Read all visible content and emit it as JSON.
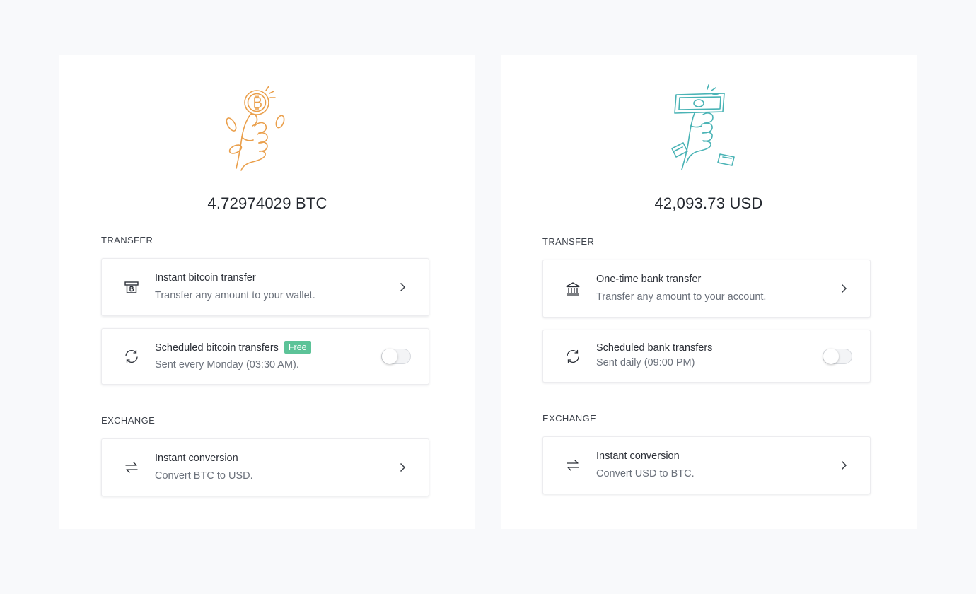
{
  "btc_panel": {
    "balance": "4.72974029 BTC",
    "illustration_color": "#ea9f4b",
    "transfer_label": "TRANSFER",
    "instant": {
      "title": "Instant bitcoin transfer",
      "subtitle": "Transfer any amount to your wallet.",
      "icon": "bitcoin-atm-icon"
    },
    "scheduled": {
      "title": "Scheduled bitcoin transfers",
      "badge": "Free",
      "subtitle": "Sent every Monday (03:30 AM).",
      "icon": "refresh-icon",
      "enabled": false
    },
    "exchange_label": "EXCHANGE",
    "conversion": {
      "title": "Instant conversion",
      "subtitle": "Convert BTC to USD.",
      "icon": "swap-arrows-icon"
    }
  },
  "usd_panel": {
    "balance": "42,093.73 USD",
    "illustration_color": "#49b3b5",
    "transfer_label": "TRANSFER",
    "onetime": {
      "title": "One-time bank transfer",
      "subtitle": "Transfer any amount to your account.",
      "icon": "bank-icon"
    },
    "scheduled": {
      "title": "Scheduled bank transfers",
      "subtitle": "Sent daily (09:00 PM)",
      "icon": "refresh-icon",
      "enabled": false
    },
    "exchange_label": "EXCHANGE",
    "conversion": {
      "title": "Instant conversion",
      "subtitle": "Convert USD to BTC.",
      "icon": "swap-arrows-icon"
    }
  },
  "colors": {
    "badge_green": "#5cc398",
    "page_background": "#f8f9fb"
  }
}
